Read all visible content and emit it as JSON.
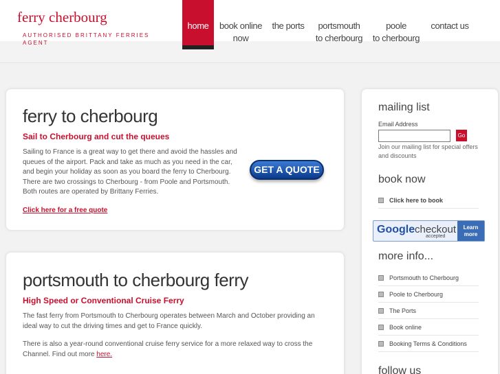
{
  "header": {
    "logo": "ferry cherbourg",
    "tagline": "AUTHORISED BRITTANY FERRIES AGENT"
  },
  "nav": [
    {
      "line1": "home",
      "line2": ""
    },
    {
      "line1": "book online",
      "line2": "now"
    },
    {
      "line1": "the ports",
      "line2": ""
    },
    {
      "line1": "portsmouth",
      "line2": "to cherbourg"
    },
    {
      "line1": "poole",
      "line2": "to cherbourg"
    },
    {
      "line1": "contact us",
      "line2": ""
    }
  ],
  "panel1": {
    "title": "ferry to cherbourg",
    "subtitle": "Sail to Cherbourg and cut the queues",
    "body": "Sailing to France is a great way to get there and avoid the hassles and queues of the airport. Pack and take as much as you need in the car, and begin your holiday as soon as you board the ferry to Cherbourg. There are two crossings to Cherbourg - from Poole and Portsmouth. Both routes are operated by Brittany Ferries.",
    "link": "Click here for a free quote",
    "quote_button": "GET A QUOTE"
  },
  "panel2": {
    "title": "portsmouth to cherbourg ferry",
    "subtitle": "High Speed or Conventional Cruise Ferry",
    "body1": "The fast ferry from Portsmouth to Cherbourg operates between March and October providing an ideal way to cut the driving times and get to France quickly.",
    "body2": "There is also a year-round conventional cruise ferry service for a more relaxed way to cross the Channel. Find out more",
    "body2_link": "here."
  },
  "sidebar": {
    "mailing_title": "mailing list",
    "email_label": "Email Address",
    "email_value": "",
    "go_label": "Go",
    "mailing_note": "Join our mailing list for special offers and discounts",
    "book_title": "book now",
    "book_link": "Click here to book",
    "checkout": {
      "google": "Google",
      "checkout": "checkout",
      "accepted": "accepted",
      "learn1": "Learn",
      "learn2": "more"
    },
    "more_title": "more info...",
    "more_links": [
      "Portsmouth to Cherbourg",
      "Poole to Cherbourg",
      "The Ports",
      "Book online",
      "Booking Terms & Conditions"
    ],
    "follow_title": "follow us"
  }
}
